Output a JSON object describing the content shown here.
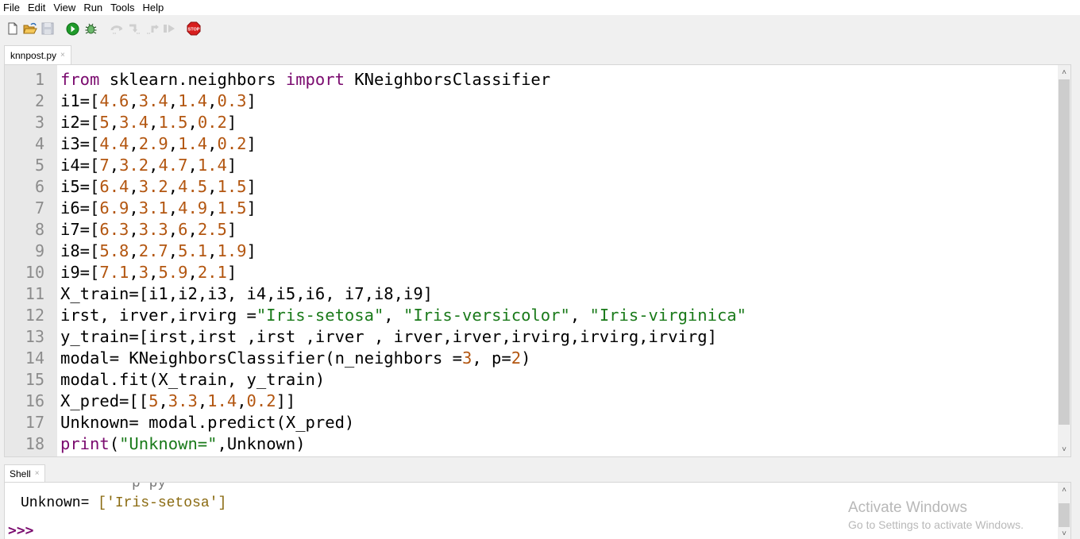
{
  "menubar": {
    "items": [
      "File",
      "Edit",
      "View",
      "Run",
      "Tools",
      "Help"
    ]
  },
  "toolbar": {
    "buttons": [
      {
        "name": "new-file",
        "icon": "new-file-icon"
      },
      {
        "name": "open-file",
        "icon": "folder-open-icon"
      },
      {
        "name": "save-file",
        "icon": "save-icon",
        "disabled": true
      },
      {
        "name": "run",
        "icon": "run-icon"
      },
      {
        "name": "debug",
        "icon": "bug-icon"
      },
      {
        "name": "step-over",
        "icon": "step-over-icon",
        "disabled": true
      },
      {
        "name": "step-into",
        "icon": "step-into-icon",
        "disabled": true
      },
      {
        "name": "step-out",
        "icon": "step-out-icon",
        "disabled": true
      },
      {
        "name": "resume",
        "icon": "resume-icon",
        "disabled": true
      },
      {
        "name": "stop",
        "icon": "stop-icon",
        "label": "STOP"
      }
    ]
  },
  "editor": {
    "tab": {
      "label": "knnpost.py",
      "close": "×"
    },
    "lines": [
      {
        "n": "1",
        "tokens": [
          [
            "kw",
            "from"
          ],
          [
            "t",
            " sklearn.neighbors "
          ],
          [
            "kw",
            "import"
          ],
          [
            "t",
            " KNeighborsClassifier"
          ]
        ]
      },
      {
        "n": "2",
        "tokens": [
          [
            "t",
            "i1=["
          ],
          [
            "num",
            "4.6"
          ],
          [
            "t",
            ","
          ],
          [
            "num",
            "3.4"
          ],
          [
            "t",
            ","
          ],
          [
            "num",
            "1.4"
          ],
          [
            "t",
            ","
          ],
          [
            "num",
            "0.3"
          ],
          [
            "t",
            "]"
          ]
        ]
      },
      {
        "n": "3",
        "tokens": [
          [
            "t",
            "i2=["
          ],
          [
            "num",
            "5"
          ],
          [
            "t",
            ","
          ],
          [
            "num",
            "3.4"
          ],
          [
            "t",
            ","
          ],
          [
            "num",
            "1.5"
          ],
          [
            "t",
            ","
          ],
          [
            "num",
            "0.2"
          ],
          [
            "t",
            "]"
          ]
        ]
      },
      {
        "n": "4",
        "tokens": [
          [
            "t",
            "i3=["
          ],
          [
            "num",
            "4.4"
          ],
          [
            "t",
            ","
          ],
          [
            "num",
            "2.9"
          ],
          [
            "t",
            ","
          ],
          [
            "num",
            "1.4"
          ],
          [
            "t",
            ","
          ],
          [
            "num",
            "0.2"
          ],
          [
            "t",
            "]"
          ]
        ]
      },
      {
        "n": "5",
        "tokens": [
          [
            "t",
            "i4=["
          ],
          [
            "num",
            "7"
          ],
          [
            "t",
            ","
          ],
          [
            "num",
            "3.2"
          ],
          [
            "t",
            ","
          ],
          [
            "num",
            "4.7"
          ],
          [
            "t",
            ","
          ],
          [
            "num",
            "1.4"
          ],
          [
            "t",
            "]"
          ]
        ]
      },
      {
        "n": "6",
        "tokens": [
          [
            "t",
            "i5=["
          ],
          [
            "num",
            "6.4"
          ],
          [
            "t",
            ","
          ],
          [
            "num",
            "3.2"
          ],
          [
            "t",
            ","
          ],
          [
            "num",
            "4.5"
          ],
          [
            "t",
            ","
          ],
          [
            "num",
            "1.5"
          ],
          [
            "t",
            "]"
          ]
        ]
      },
      {
        "n": "7",
        "tokens": [
          [
            "t",
            "i6=["
          ],
          [
            "num",
            "6.9"
          ],
          [
            "t",
            ","
          ],
          [
            "num",
            "3.1"
          ],
          [
            "t",
            ","
          ],
          [
            "num",
            "4.9"
          ],
          [
            "t",
            ","
          ],
          [
            "num",
            "1.5"
          ],
          [
            "t",
            "]"
          ]
        ]
      },
      {
        "n": "8",
        "tokens": [
          [
            "t",
            "i7=["
          ],
          [
            "num",
            "6.3"
          ],
          [
            "t",
            ","
          ],
          [
            "num",
            "3.3"
          ],
          [
            "t",
            ","
          ],
          [
            "num",
            "6"
          ],
          [
            "t",
            ","
          ],
          [
            "num",
            "2.5"
          ],
          [
            "t",
            "]"
          ]
        ]
      },
      {
        "n": "9",
        "tokens": [
          [
            "t",
            "i8=["
          ],
          [
            "num",
            "5.8"
          ],
          [
            "t",
            ","
          ],
          [
            "num",
            "2.7"
          ],
          [
            "t",
            ","
          ],
          [
            "num",
            "5.1"
          ],
          [
            "t",
            ","
          ],
          [
            "num",
            "1.9"
          ],
          [
            "t",
            "]"
          ]
        ]
      },
      {
        "n": "10",
        "tokens": [
          [
            "t",
            "i9=["
          ],
          [
            "num",
            "7.1"
          ],
          [
            "t",
            ","
          ],
          [
            "num",
            "3"
          ],
          [
            "t",
            ","
          ],
          [
            "num",
            "5.9"
          ],
          [
            "t",
            ","
          ],
          [
            "num",
            "2.1"
          ],
          [
            "t",
            "]"
          ]
        ]
      },
      {
        "n": "11",
        "tokens": [
          [
            "t",
            "X_train=[i1,i2,i3, i4,i5,i6, i7,i8,i9]"
          ]
        ]
      },
      {
        "n": "12",
        "tokens": [
          [
            "t",
            "irst, irver,irvirg ="
          ],
          [
            "str",
            "\"Iris-setosa\""
          ],
          [
            "t",
            ", "
          ],
          [
            "str",
            "\"Iris-versicolor\""
          ],
          [
            "t",
            ", "
          ],
          [
            "str",
            "\"Iris-virginica\""
          ]
        ]
      },
      {
        "n": "13",
        "tokens": [
          [
            "t",
            "y_train=[irst,irst ,irst ,irver , irver,irver,irvirg,irvirg,irvirg]"
          ]
        ]
      },
      {
        "n": "14",
        "tokens": [
          [
            "t",
            "modal= KNeighborsClassifier(n_neighbors ="
          ],
          [
            "num",
            "3"
          ],
          [
            "t",
            ", p="
          ],
          [
            "num",
            "2"
          ],
          [
            "t",
            ")"
          ]
        ]
      },
      {
        "n": "15",
        "tokens": [
          [
            "t",
            "modal.fit(X_train, y_train)"
          ]
        ]
      },
      {
        "n": "16",
        "tokens": [
          [
            "t",
            "X_pred=[["
          ],
          [
            "num",
            "5"
          ],
          [
            "t",
            ","
          ],
          [
            "num",
            "3.3"
          ],
          [
            "t",
            ","
          ],
          [
            "num",
            "1.4"
          ],
          [
            "t",
            ","
          ],
          [
            "num",
            "0.2"
          ],
          [
            "t",
            "]]"
          ]
        ]
      },
      {
        "n": "17",
        "tokens": [
          [
            "t",
            "Unknown= modal.predict(X_pred)"
          ]
        ]
      },
      {
        "n": "18",
        "tokens": [
          [
            "kw",
            "print"
          ],
          [
            "t",
            "("
          ],
          [
            "str",
            "\"Unknown=\""
          ],
          [
            "t",
            ",Unknown)"
          ]
        ]
      }
    ]
  },
  "shell": {
    "tab": {
      "label": "Shell",
      "close": "×"
    },
    "partial_line": "    p   py",
    "output_prefix": "Unknown= ",
    "output_value": "['Iris-setosa']",
    "prompt": ">>>"
  },
  "watermark": {
    "title": "Activate Windows",
    "subtitle": "Go to Settings to activate Windows."
  },
  "colors": {
    "keyword": "#7a0a6e",
    "number": "#b35610",
    "string": "#1a7a1a",
    "gutter_bg": "#e8e8e8"
  }
}
